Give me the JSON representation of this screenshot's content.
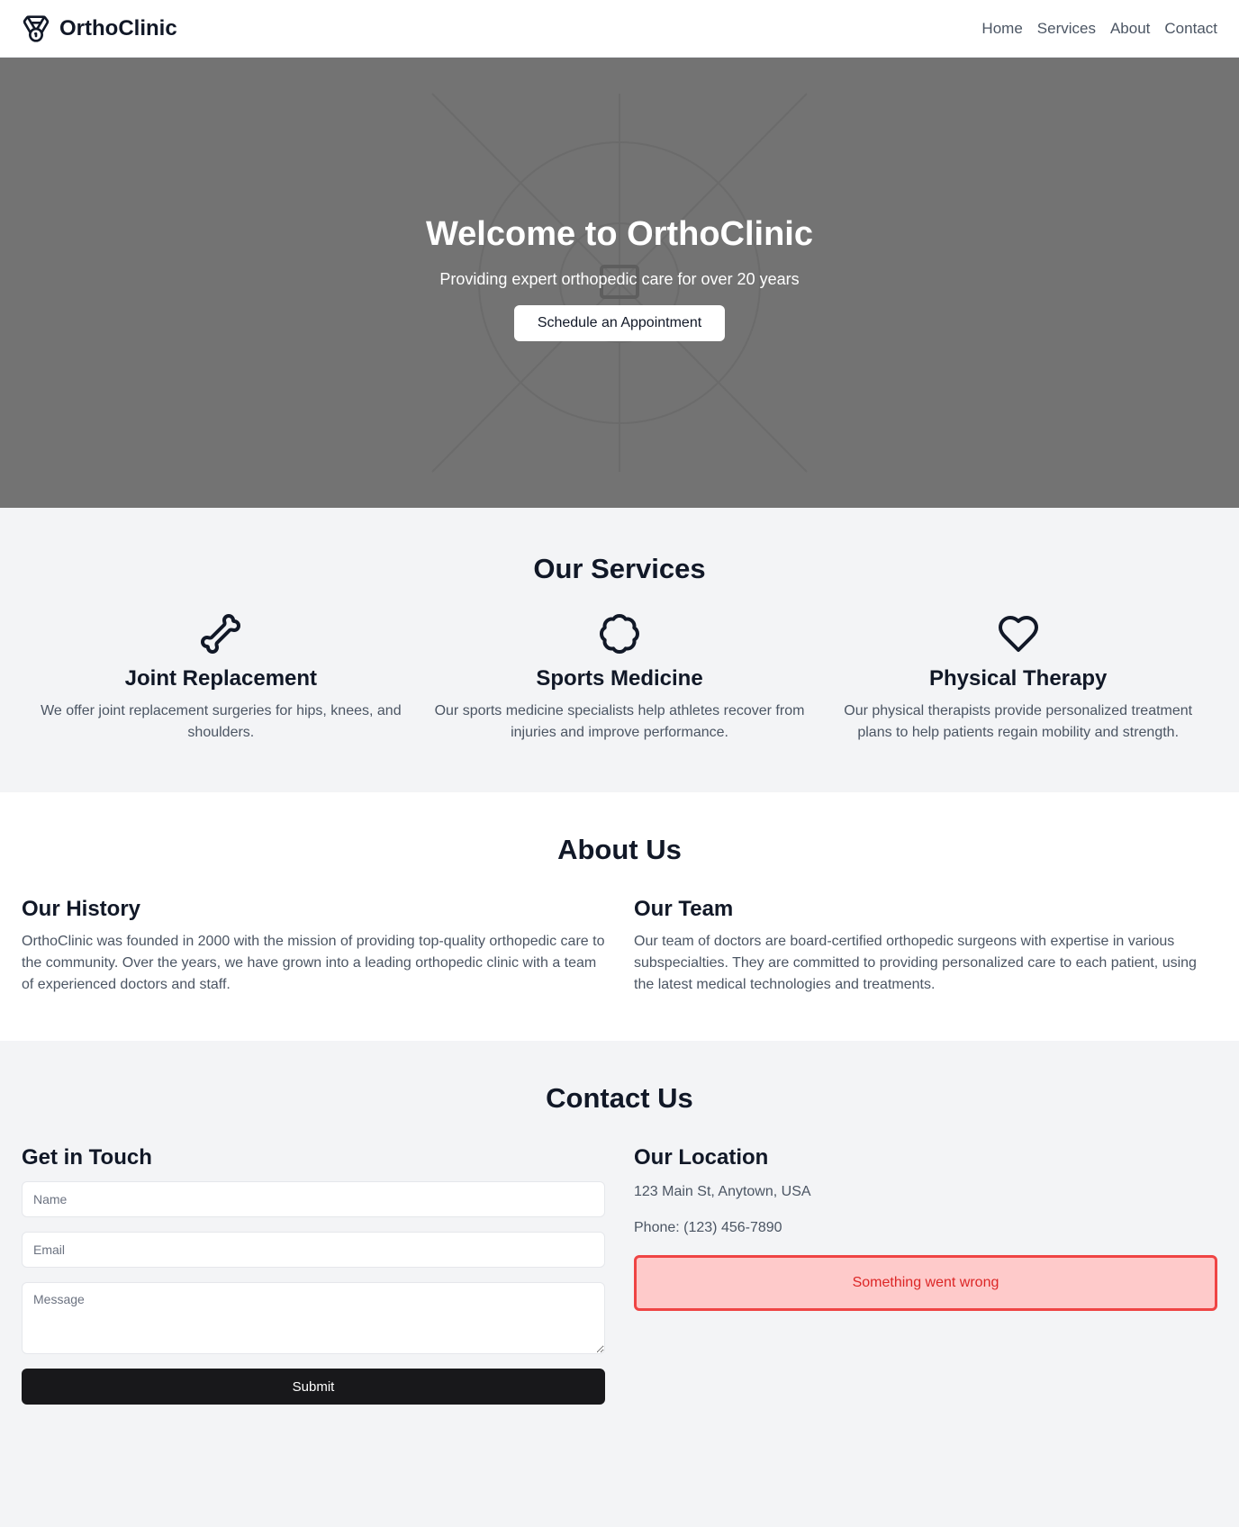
{
  "header": {
    "brand": "OrthoClinic",
    "nav": [
      "Home",
      "Services",
      "About",
      "Contact"
    ]
  },
  "hero": {
    "title": "Welcome to OrthoClinic",
    "subtitle": "Providing expert orthopedic care for over 20 years",
    "cta": "Schedule an Appointment"
  },
  "services": {
    "title": "Our Services",
    "items": [
      {
        "icon": "bone-icon",
        "title": "Joint Replacement",
        "text": "We offer joint replacement surgeries for hips, knees, and shoulders."
      },
      {
        "icon": "badge-icon",
        "title": "Sports Medicine",
        "text": "Our sports medicine specialists help athletes recover from injuries and improve performance."
      },
      {
        "icon": "heart-icon",
        "title": "Physical Therapy",
        "text": "Our physical therapists provide personalized treatment plans to help patients regain mobility and strength."
      }
    ]
  },
  "about": {
    "title": "About Us",
    "history": {
      "title": "Our History",
      "text": "OrthoClinic was founded in 2000 with the mission of providing top-quality orthopedic care to the community. Over the years, we have grown into a leading orthopedic clinic with a team of experienced doctors and staff."
    },
    "team": {
      "title": "Our Team",
      "text": "Our team of doctors are board-certified orthopedic surgeons with expertise in various subspecialties. They are committed to providing personalized care to each patient, using the latest medical technologies and treatments."
    }
  },
  "contact": {
    "title": "Contact Us",
    "form": {
      "title": "Get in Touch",
      "name_placeholder": "Name",
      "email_placeholder": "Email",
      "message_placeholder": "Message",
      "submit": "Submit"
    },
    "location": {
      "title": "Our Location",
      "address": "123 Main St, Anytown, USA",
      "phone": "Phone: (123) 456-7890",
      "error": "Something went wrong"
    }
  },
  "colors": {
    "hero_bg": "#737373",
    "error_bg": "#fecaca",
    "error_border": "#ef4444",
    "button_dark": "#18181b"
  }
}
